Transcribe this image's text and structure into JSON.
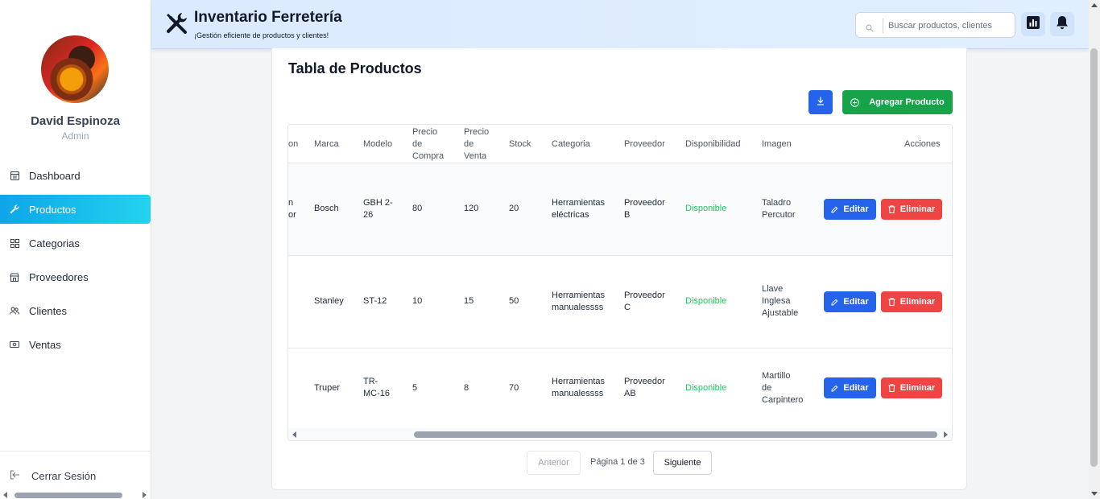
{
  "app": {
    "title": "Inventario Ferretería",
    "subtitle": "¡Gestión eficiente de productos y clientes!"
  },
  "search": {
    "placeholder": "Buscar productos, clientes"
  },
  "user": {
    "name": "David Espinoza",
    "role": "Admin"
  },
  "sidebar": {
    "items": [
      {
        "label": "Dashboard",
        "icon": "dashboard-icon",
        "active": false
      },
      {
        "label": "Productos",
        "icon": "wrench-icon",
        "active": true
      },
      {
        "label": "Categorias",
        "icon": "grid-icon",
        "active": false
      },
      {
        "label": "Proveedores",
        "icon": "store-icon",
        "active": false
      },
      {
        "label": "Clientes",
        "icon": "users-icon",
        "active": false
      },
      {
        "label": "Ventas",
        "icon": "cash-icon",
        "active": false
      }
    ],
    "logout_label": "Cerrar Sesión"
  },
  "main": {
    "title": "Tabla de Productos",
    "add_button": "Agregar Producto",
    "table": {
      "headers": {
        "partial": "on",
        "marca": "Marca",
        "modelo": "Modelo",
        "precio_compra": [
          "Precio",
          "de",
          "Compra"
        ],
        "precio_venta": [
          "Precio",
          "de",
          "Venta"
        ],
        "stock": "Stock",
        "categoria": "Categoria",
        "proveedor": "Proveedor",
        "disponibilidad": "Disponibilidad",
        "imagen": "Imagen",
        "acciones": "Acciones"
      },
      "rows": [
        {
          "partial": [
            "n",
            "or"
          ],
          "marca": "Bosch",
          "modelo": [
            "GBH 2-",
            "26"
          ],
          "precio_compra": "80",
          "precio_venta": "120",
          "stock": "20",
          "categoria": [
            "Herramientas",
            "eléctricas"
          ],
          "proveedor": [
            "Proveedor",
            "B"
          ],
          "disponibilidad": "Disponible",
          "imagen": [
            "Taladro",
            "Percutor"
          ]
        },
        {
          "partial": [
            "",
            ""
          ],
          "marca": "Stanley",
          "modelo": [
            "ST-12",
            ""
          ],
          "precio_compra": "10",
          "precio_venta": "15",
          "stock": "50",
          "categoria": [
            "Herramientas",
            "manualessss"
          ],
          "proveedor": [
            "Proveedor",
            "C"
          ],
          "disponibilidad": "Disponible",
          "imagen": [
            "Llave",
            "Inglesa",
            "Ajustable"
          ]
        },
        {
          "partial": [
            "",
            ""
          ],
          "marca": "Truper",
          "modelo": [
            "TR-",
            "MC-16"
          ],
          "precio_compra": "5",
          "precio_venta": "8",
          "stock": "70",
          "categoria": [
            "Herramientas",
            "manualessss"
          ],
          "proveedor": [
            "Proveedor",
            "AB"
          ],
          "disponibilidad": "Disponible",
          "imagen": [
            "Martillo",
            "de",
            "Carpintero"
          ]
        }
      ],
      "edit_label": "Editar",
      "delete_label": "Eliminar"
    },
    "pagination": {
      "prev": "Anterior",
      "info": "Página 1 de 3",
      "next": "Siguiente"
    }
  },
  "colors": {
    "accent": "#22d3ee",
    "primary": "#2563eb",
    "success": "#16a34a",
    "danger": "#ef4444"
  }
}
